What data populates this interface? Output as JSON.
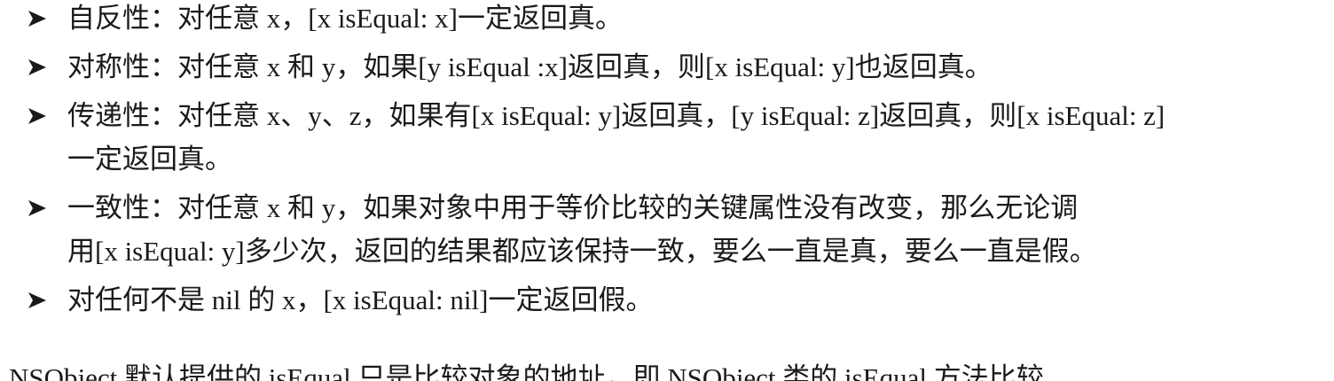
{
  "bullets": [
    {
      "lines": [
        "自反性：对任意 x，[x isEqual: x]一定返回真。"
      ]
    },
    {
      "lines": [
        "对称性：对任意 x 和 y，如果[y isEqual :x]返回真，则[x isEqual: y]也返回真。"
      ]
    },
    {
      "lines": [
        "传递性：对任意 x、y、z，如果有[x isEqual: y]返回真，[y isEqual: z]返回真，则[x isEqual: z]",
        "一定返回真。"
      ]
    },
    {
      "lines": [
        "一致性：对任意 x 和 y，如果对象中用于等价比较的关键属性没有改变，那么无论调",
        "用[x isEqual: y]多少次，返回的结果都应该保持一致，要么一直是真，要么一直是假。"
      ]
    },
    {
      "lines": [
        "对任何不是 nil 的 x，[x isEqual: nil]一定返回假。"
      ]
    }
  ],
  "trailing_paragraph": "NSObject 默认提供的 isEqual 只是比较对象的地址，即 NSObject 类的 isEqual 方法比较"
}
